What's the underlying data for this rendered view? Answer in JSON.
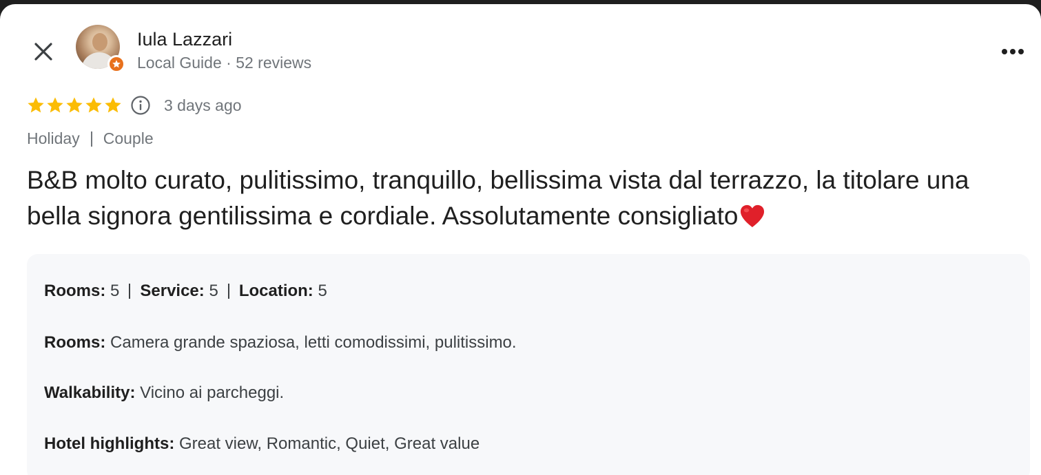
{
  "header": {
    "close_icon": "close-icon",
    "user_name": "Iula Lazzari",
    "user_meta": "Local Guide · 52 reviews",
    "more_icon": "more-horizontal-icon",
    "badge_color": "#e8711d"
  },
  "rating": {
    "stars": 5,
    "max_stars": 5,
    "star_color": "#fbbc04",
    "info_icon": "info-icon",
    "time_ago": "3 days ago"
  },
  "tags": [
    "Holiday",
    "Couple"
  ],
  "review": {
    "text": "B&B molto curato, pulitissimo, tranquillo, bellissima vista dal terrazzo, la titolare una bella signora gentilissima e cordiale. Assolutamente consigliato",
    "emoji": "heart-emoji"
  },
  "details": {
    "scores": [
      {
        "label": "Rooms:",
        "value": "5"
      },
      {
        "label": "Service:",
        "value": "5"
      },
      {
        "label": "Location:",
        "value": "5"
      }
    ],
    "rooms": {
      "label": "Rooms:",
      "value": "Camera grande spaziosa, letti comodissimi, pulitissimo."
    },
    "walkability": {
      "label": "Walkability:",
      "value": "Vicino ai parcheggi."
    },
    "highlights": {
      "label": "Hotel highlights:",
      "value": "Great view, Romantic, Quiet, Great value"
    }
  }
}
